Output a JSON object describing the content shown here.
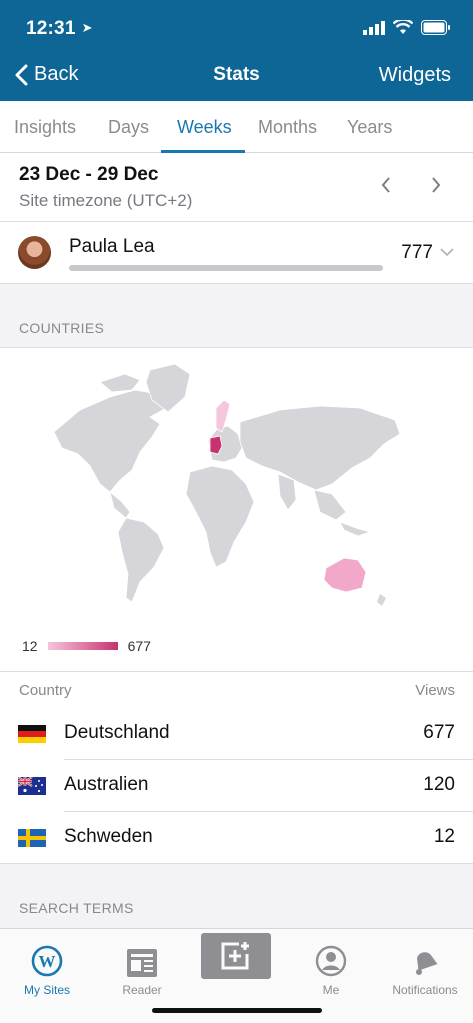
{
  "status": {
    "time": "12:31"
  },
  "nav": {
    "back_label": "Back",
    "title": "Stats",
    "right_label": "Widgets"
  },
  "tabs": [
    {
      "label": "Insights",
      "active": false
    },
    {
      "label": "Days",
      "active": false
    },
    {
      "label": "Weeks",
      "active": true
    },
    {
      "label": "Months",
      "active": false
    },
    {
      "label": "Years",
      "active": false
    }
  ],
  "period": {
    "range": "23 Dec - 29 Dec",
    "timezone": "Site timezone (UTC+2)"
  },
  "author": {
    "name": "Paula Lea",
    "views": "777"
  },
  "countries": {
    "section_title": "COUNTRIES",
    "legend_min": "12",
    "legend_max": "677",
    "col_country": "Country",
    "col_views": "Views",
    "rows": [
      {
        "name": "Deutschland",
        "views": "677",
        "flag": "flag-germany-icon"
      },
      {
        "name": "Australien",
        "views": "120",
        "flag": "flag-australia-icon"
      },
      {
        "name": "Schweden",
        "views": "12",
        "flag": "flag-sweden-icon"
      }
    ]
  },
  "search_terms": {
    "section_title": "SEARCH TERMS"
  },
  "tabbar": {
    "items": [
      {
        "label": "My Sites",
        "icon": "wordpress-icon",
        "active": true
      },
      {
        "label": "Reader",
        "icon": "reader-icon",
        "active": false
      },
      {
        "label": "",
        "icon": "write-post-icon",
        "active": false
      },
      {
        "label": "Me",
        "icon": "profile-icon",
        "active": false
      },
      {
        "label": "Notifications",
        "icon": "bell-icon",
        "active": false
      }
    ]
  },
  "colors": {
    "brand": "#0e6697",
    "accent": "#1a78b0",
    "map_low": "#f5c6dd",
    "map_high": "#c7336e",
    "map_land": "#d6d6da"
  }
}
